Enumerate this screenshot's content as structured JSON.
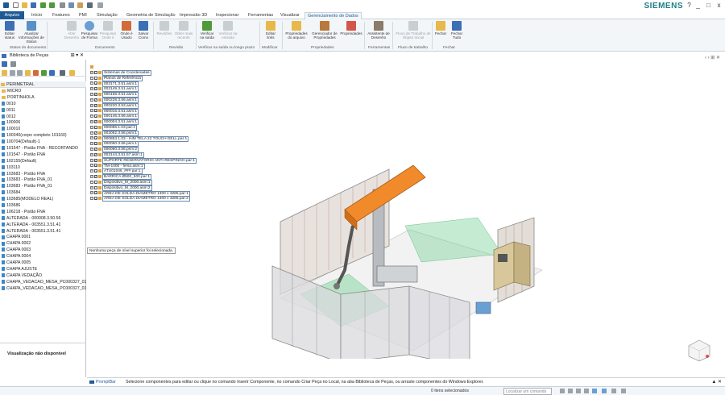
{
  "title_bar": {
    "brand": "SIEMENS",
    "window_controls": [
      "?",
      "_",
      "□",
      "x"
    ],
    "qat_icons": [
      "app-icon",
      "new-icon",
      "open-icon",
      "save-icon",
      "undo-icon",
      "redo-icon",
      "cut-icon",
      "copy-icon",
      "paste-icon",
      "print-icon",
      "options-icon"
    ]
  },
  "tabs": [
    {
      "label": "Arquivo",
      "kind": "file"
    },
    {
      "label": "Início"
    },
    {
      "label": "Features"
    },
    {
      "label": "PMI"
    },
    {
      "label": "Simulação"
    },
    {
      "label": "Geometria de Simulação"
    },
    {
      "label": "Impressão 3D"
    },
    {
      "label": "Inspecionar"
    },
    {
      "label": "Ferramentas"
    },
    {
      "label": "Visualizar"
    },
    {
      "label": "Gerenciamento de Dados",
      "active": true
    }
  ],
  "ribbon": {
    "buttons": [
      {
        "label": "Editar status",
        "enabled": true,
        "icon": "edit-status-icon"
      },
      {
        "label": "Atualizar Informações de Status",
        "enabled": true,
        "icon": "update-status-icon"
      },
      {
        "label": "Abrir Desenho",
        "enabled": false,
        "icon": "open-drawing-icon"
      },
      {
        "label": "Pesquisar de Forma",
        "enabled": true,
        "icon": "search-shape-icon"
      },
      {
        "label": "Pesquisar Onde é",
        "enabled": false,
        "icon": "search-where-icon"
      },
      {
        "label": "Onde é Usado",
        "enabled": true,
        "icon": "where-used-icon"
      },
      {
        "label": "Salvar Como",
        "enabled": true,
        "icon": "save-as-icon"
      },
      {
        "label": "Revisões",
        "enabled": false,
        "icon": "revisions-icon"
      },
      {
        "label": "Obter mais recente",
        "enabled": false,
        "icon": "get-latest-icon"
      },
      {
        "label": "Verificar na saída",
        "enabled": true,
        "icon": "check-out-icon"
      },
      {
        "label": "Verificar na entrada",
        "enabled": false,
        "icon": "check-in-icon"
      },
      {
        "label": "Editar links",
        "enabled": true,
        "icon": "edit-links-icon"
      },
      {
        "label": "Propriedades do arquivo",
        "enabled": true,
        "icon": "file-properties-icon"
      },
      {
        "label": "Gerenciador de Propriedades",
        "enabled": true,
        "icon": "property-manager-icon"
      },
      {
        "label": "Propriedades",
        "enabled": true,
        "icon": "properties-icon"
      },
      {
        "label": "Assistente de Desenho",
        "enabled": true,
        "icon": "drawing-wizard-icon"
      },
      {
        "label": "Fluxo de Trabalho de Objeto Inicial",
        "enabled": false,
        "icon": "workflow-icon"
      },
      {
        "label": "Fechar",
        "enabled": true,
        "icon": "close-folder-icon"
      },
      {
        "label": "Fechar Tudo",
        "enabled": true,
        "icon": "close-all-icon"
      }
    ],
    "groups": [
      "Status do documento",
      "Documento",
      "Revisão",
      "Verificar na saída ou longo prazo",
      "Modificar",
      "Propriedades",
      "Ferramentas",
      "Fluxo de trabalho",
      "Fechar"
    ]
  },
  "library": {
    "title": "Biblioteca de Peças",
    "current_folder": "PERIMETRAL",
    "items": [
      {
        "label": "MICRO",
        "type": "folder"
      },
      {
        "label": "PORTINHOLA",
        "type": "folder"
      },
      {
        "label": "0010",
        "type": "file"
      },
      {
        "label": "0011",
        "type": "file"
      },
      {
        "label": "0012",
        "type": "file"
      },
      {
        "label": "100006",
        "type": "file"
      },
      {
        "label": "100010",
        "type": "file"
      },
      {
        "label": "100340(corpo completo 101160)",
        "type": "file"
      },
      {
        "label": "100704(Default)-1",
        "type": "file"
      },
      {
        "label": "101547 - Pistão FNA - RECORTANDO",
        "type": "file"
      },
      {
        "label": "101547 - Pistão FNA",
        "type": "file"
      },
      {
        "label": "102155(Default)",
        "type": "file"
      },
      {
        "label": "103110",
        "type": "file"
      },
      {
        "label": "103683 - Pistão FNA",
        "type": "file"
      },
      {
        "label": "103683 - Pistão FNA_01",
        "type": "file"
      },
      {
        "label": "103683 - Pistão FNA_01",
        "type": "file"
      },
      {
        "label": "103684",
        "type": "file"
      },
      {
        "label": "103685(MODELO REAL)",
        "type": "file"
      },
      {
        "label": "103686",
        "type": "file"
      },
      {
        "label": "106218 - Pistão FNA",
        "type": "file"
      },
      {
        "label": "ALTERADA - 000008.3.50.56",
        "type": "file"
      },
      {
        "label": "ALTERADA - 003551.3.51.41",
        "type": "file"
      },
      {
        "label": "ALTERADA - 003551.3.51.41",
        "type": "file"
      },
      {
        "label": "CHAPA 0001",
        "type": "file"
      },
      {
        "label": "CHAPA 0002",
        "type": "file"
      },
      {
        "label": "CHAPA 0003",
        "type": "file"
      },
      {
        "label": "CHAPA 0004",
        "type": "file"
      },
      {
        "label": "CHAPA 0005",
        "type": "file"
      },
      {
        "label": "CHAPA AJUSTE",
        "type": "file"
      },
      {
        "label": "CHAPA VEDAÇÃO",
        "type": "file"
      },
      {
        "label": "CHAPA_VEDACAO_MESA_PC000327_01",
        "type": "file"
      },
      {
        "label": "CHAPA_VEDACAO_MESA_PC000327_01",
        "type": "file"
      }
    ],
    "preview_text": "Visualização não disponível"
  },
  "tree": [
    {
      "label": "Sistemas de Coordenadas",
      "checked": false,
      "boxed": true
    },
    {
      "label": "Planos de Referência",
      "checked": false,
      "boxed": true
    },
    {
      "label": "003171.3.51.asm:1",
      "checked": true,
      "boxed": true
    },
    {
      "label": "003149.3.51.asm:1",
      "checked": true,
      "boxed": true
    },
    {
      "label": "000155.3.51.asm:1",
      "checked": true,
      "boxed": true
    },
    {
      "label": "000228.3.56.asm:1",
      "checked": true,
      "boxed": true
    },
    {
      "label": "000220.3.53.asm:1",
      "checked": true,
      "boxed": true
    },
    {
      "label": "000015.3.51.asm:1",
      "checked": true,
      "boxed": true
    },
    {
      "label": "000146.3.56.asm:1",
      "checked": true,
      "boxed": true
    },
    {
      "label": "000004.3.51.asm:1",
      "checked": true,
      "boxed": true
    },
    {
      "label": "000055.1.03.par:1",
      "checked": false,
      "boxed": true
    },
    {
      "label": "002052.3.56.psm:1",
      "checked": true,
      "boxed": true
    },
    {
      "label": "000853.1.03 - IHM TELA 22 TOUCH DELL.par:1",
      "checked": true,
      "boxed": true
    },
    {
      "label": "000060.3.56.psm:1",
      "checked": true,
      "boxed": true
    },
    {
      "label": "000060.3.56.psm:2",
      "checked": true,
      "boxed": true
    },
    {
      "label": "003144.3.51.57.asm:1",
      "checked": true,
      "boxed": true
    },
    {
      "label": "SUPORTE RESERVATÓRIO ANTI-RESPINGO.par:1",
      "checked": true,
      "boxed": true
    },
    {
      "label": "TM-1000 - ferso.asm:1",
      "checked": true,
      "boxed": true
    },
    {
      "label": "ATU01046_### par:1",
      "checked": true,
      "boxed": true
    },
    {
      "label": "BARRICA Ø500_500.par:1",
      "checked": true,
      "boxed": true
    },
    {
      "label": "Dispositivo_M_2000.asm:1",
      "checked": false,
      "boxed": true
    },
    {
      "label": "Dispositivo_M_2000.asm:2",
      "checked": false,
      "boxed": true
    },
    {
      "label": "ÁREA DE SOLDA DIAMETRO 1300 x 3285.par:1",
      "checked": true,
      "boxed": true
    },
    {
      "label": "ÁREA DE SOLDA DIAMETRO 1300 x 3285.par:2",
      "checked": true,
      "boxed": true
    }
  ],
  "tooltip": "Nenhuma peça de nível superior foi selecionada.",
  "prompt": {
    "label": "PromptBar",
    "text": "Selecione componentes para editar ou clique no comando Inserir Componente, no comando Criar Peça no Local, na aba Biblioteca de Peças, ou arraste componentes do Windows Explorer."
  },
  "status": {
    "selection": "0 itens selecionados",
    "command_placeholder": "Localizar um comando"
  },
  "colors": {
    "accent": "#1f5a96",
    "brand": "#1d7d86",
    "robot_orange": "#f08a2a",
    "cell_green": "#7fd49b",
    "panel_bg": "#f3f6f9"
  }
}
